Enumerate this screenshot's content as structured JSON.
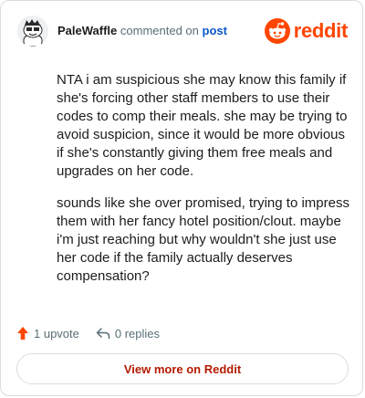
{
  "comment": {
    "author": "PaleWaffle",
    "action_text": "commented on",
    "post_link": "post",
    "paragraphs": [
      "NTA i am suspicious she may know this family if she's forcing other staff members to use their codes to comp their meals. she may be trying to avoid suspicion, since it would be more obvious if she's constantly giving them free meals and upgrades on her code.",
      "sounds like she over promised, trying to impress them with her fancy hotel position/clout. maybe i'm just reaching but why wouldn't she just use her code if the family actually deserves compensation?"
    ]
  },
  "brand": {
    "name": "reddit",
    "icon": "reddit-logo-icon",
    "color": "#ff4500"
  },
  "actions": {
    "upvote_label": "1 upvote",
    "upvote_icon": "upvote-arrow-icon",
    "replies_label": "0 replies",
    "replies_icon": "reply-arrow-icon"
  },
  "view_more_label": "View more on Reddit"
}
